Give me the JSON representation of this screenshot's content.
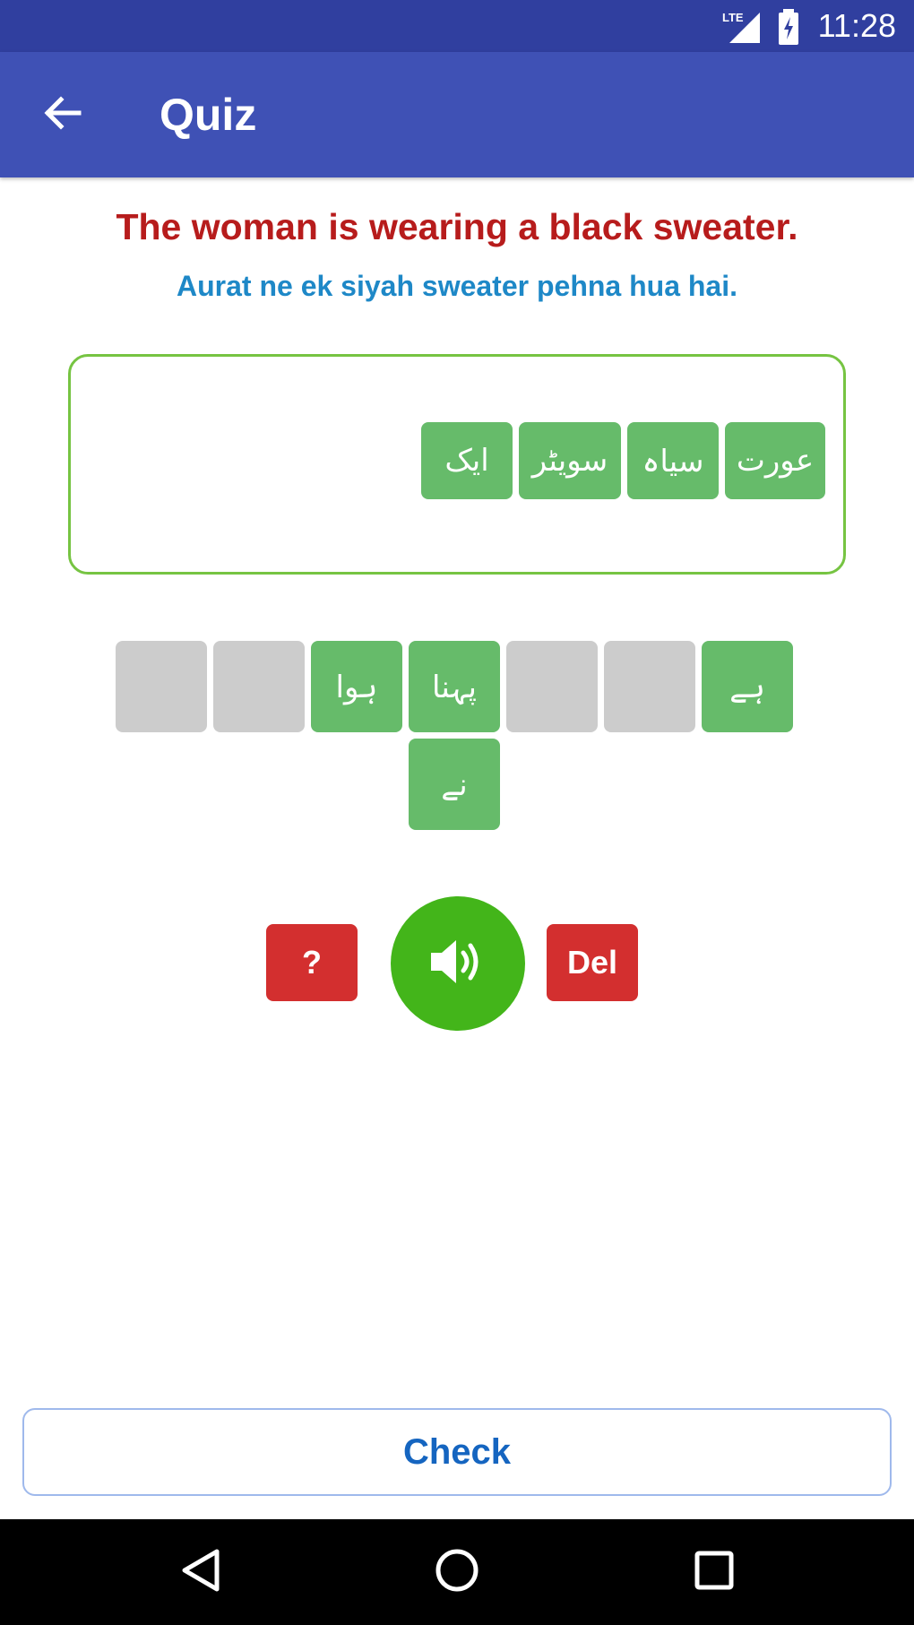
{
  "status_bar": {
    "time": "11:28",
    "network": "LTE",
    "icons": [
      "lte-signal-icon",
      "battery-charging-icon"
    ]
  },
  "app_bar": {
    "title": "Quiz",
    "back_icon": "arrow-back-icon"
  },
  "question": {
    "english": "The woman is wearing a black sweater.",
    "transliteration": "Aurat ne ek siyah sweater pehna hua hai."
  },
  "answer_words": [
    "عورت",
    "سیاہ",
    "سویٹر",
    "ایک"
  ],
  "word_bank": {
    "row1": [
      "",
      "",
      "ہوا",
      "پہنا",
      "",
      "",
      "ہے"
    ],
    "row2": [
      "نے"
    ]
  },
  "controls": {
    "hint_label": "?",
    "audio_icon": "speaker-icon",
    "delete_label": "Del"
  },
  "check_label": "Check",
  "nav": [
    "back-nav-icon",
    "home-nav-icon",
    "recents-nav-icon"
  ],
  "colors": {
    "primary": "#3f51b5",
    "status": "#303f9f",
    "tile": "#66bb6a",
    "tile_empty": "#cccccc",
    "accent_red": "#d32f2f",
    "audio_green": "#43b51a",
    "title_red": "#b71c1c",
    "subtitle_blue": "#1e88c7"
  }
}
